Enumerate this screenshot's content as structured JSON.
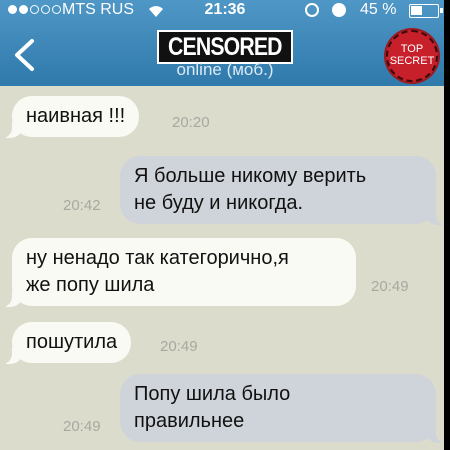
{
  "status_bar": {
    "carrier": "MTS RUS",
    "time": "21:36",
    "battery_percent": "45 %",
    "battery_level": 0.45,
    "signal_bars": 2,
    "icons": [
      "signal-dots-icon",
      "wifi-icon",
      "rotation-lock-icon",
      "alarm-icon",
      "battery-icon"
    ]
  },
  "header": {
    "back_icon": "chevron-left-icon",
    "contact_name": "CENSORED",
    "status": "online (моб.)",
    "stamp_line1": "TOP",
    "stamp_line2": "SECRET"
  },
  "messages": [
    {
      "direction": "in",
      "text": "наивная !!!",
      "time": "20:20"
    },
    {
      "direction": "out",
      "text": "Я больше никому верить\nне буду и никогда.",
      "time": "20:42"
    },
    {
      "direction": "in",
      "text": "ну ненадо так категорично,я\nже попу шила",
      "time": "20:49"
    },
    {
      "direction": "in",
      "text": "пошутила",
      "time": "20:49"
    },
    {
      "direction": "out",
      "text": "Попу шила было\nправильнее",
      "time": "20:49"
    }
  ]
}
